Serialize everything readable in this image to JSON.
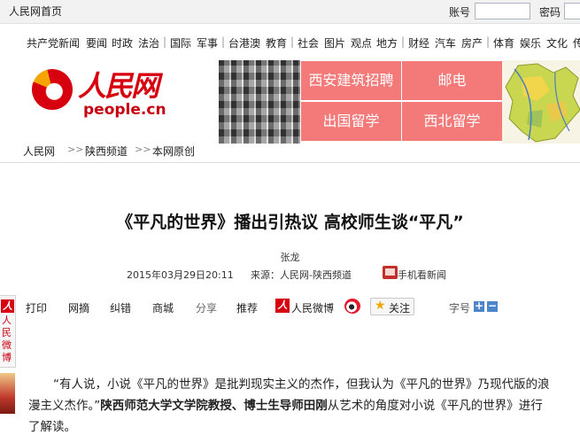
{
  "topbar": {
    "home_link": "人民网首页",
    "account_label": "账号",
    "password_label": "密码",
    "account_value": "",
    "password_value": ""
  },
  "nav": {
    "groups": [
      [
        "共产党新闻",
        "要闻",
        "时政",
        "法治"
      ],
      [
        "国际",
        "军事"
      ],
      [
        "台港澳",
        "教育"
      ],
      [
        "社会",
        "图片",
        "观点",
        "地方"
      ],
      [
        "财经",
        "汽车",
        "房产"
      ],
      [
        "体育",
        "娱乐",
        "文化",
        "传"
      ]
    ]
  },
  "logo": {
    "cn": "人民网",
    "en": "people.cn"
  },
  "banner": {
    "ads": [
      "西安建筑招聘",
      "邮电",
      "出国留学",
      "西北留学"
    ]
  },
  "breadcrumb": [
    "人民网",
    "陕西频道",
    "本网原创"
  ],
  "article": {
    "title": "《平凡的世界》播出引热议 高校师生谈“平凡”",
    "author": "张龙",
    "datetime": "2015年03月29日20:11",
    "source": "来源：人民网-陕西频道",
    "mobile_news": "手机看新闻",
    "paragraph": {
      "part1": "“有人说，小说《平凡的世界》是批判现实主义的杰作，但我认为《平凡的世界》乃现代版的浪漫主义杰作。”",
      "part2_bold": "陕西师范大学文学院教授、博士生导师田刚",
      "part3": "从艺术的角度对小说《平凡的世界》进行了解读。"
    }
  },
  "side_badge": {
    "mark": "人",
    "text": "人民微博"
  },
  "tools": {
    "print": "打印",
    "collect": "网摘",
    "correct": "纠错",
    "shop": "商城",
    "share": "分享",
    "recommend": "推荐",
    "weibo_icon": "人",
    "weibo": "人民微博",
    "follow": "关注",
    "font_size": "字号",
    "plus": "+",
    "minus": "−"
  },
  "colors": {
    "brand_red": "#d7000f",
    "ad_pink": "#f47a7a"
  }
}
